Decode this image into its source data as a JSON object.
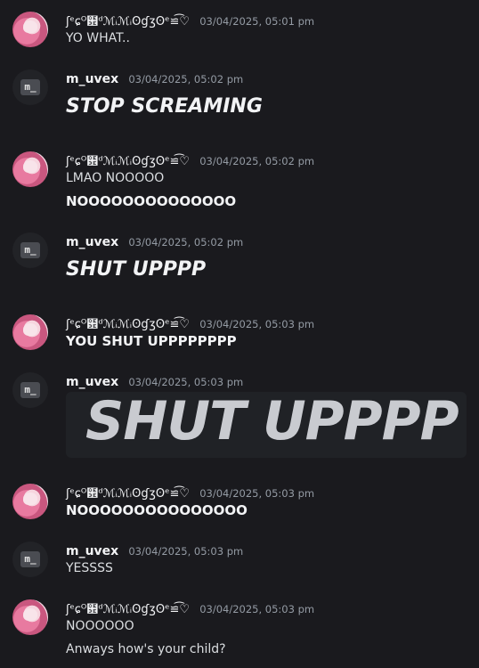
{
  "users": {
    "anime": "ʃᵉɕᴼ฾ᵈℳᵢℳᵢʘɠʒʘᵉ≌͡♡",
    "mu": "m_uvex"
  },
  "avatar_icons": {
    "anime": "anime-girl-avatar",
    "mu": "m-terminal-avatar"
  },
  "avatar_glyph": "m_",
  "messages": [
    {
      "author": "anime",
      "timestamp": "03/04/2025, 05:01 pm",
      "lines": [
        "YO WHAT.."
      ]
    },
    {
      "author": "mu",
      "timestamp": "03/04/2025, 05:02 pm",
      "lines": [
        "STOP SCREAMING"
      ]
    },
    {
      "author": "anime",
      "timestamp": "03/04/2025, 05:02 pm",
      "lines": [
        "LMAO NOOOOO",
        "NOOOOOOOOOOOOOO"
      ]
    },
    {
      "author": "mu",
      "timestamp": "03/04/2025, 05:02 pm",
      "lines": [
        "SHUT UPPPP"
      ]
    },
    {
      "author": "anime",
      "timestamp": "03/04/2025, 05:03 pm",
      "lines": [
        "YOU SHUT UPPPPPPPP"
      ]
    },
    {
      "author": "mu",
      "timestamp": "03/04/2025, 05:03 pm",
      "lines": [
        "SHUT UPPPP"
      ]
    },
    {
      "author": "anime",
      "timestamp": "03/04/2025, 05:03 pm",
      "lines": [
        "NOOOOOOOOOOOOOOO"
      ]
    },
    {
      "author": "mu",
      "timestamp": "03/04/2025, 05:03 pm",
      "lines": [
        "YESSSS"
      ]
    },
    {
      "author": "anime",
      "timestamp": "03/04/2025, 05:03 pm",
      "lines": [
        "NOOOOOO",
        "Anways how's your child?"
      ]
    }
  ],
  "colors": {
    "background": "#1a1a1e",
    "timestamp": "#949ba4",
    "text": "#dbdee1"
  }
}
